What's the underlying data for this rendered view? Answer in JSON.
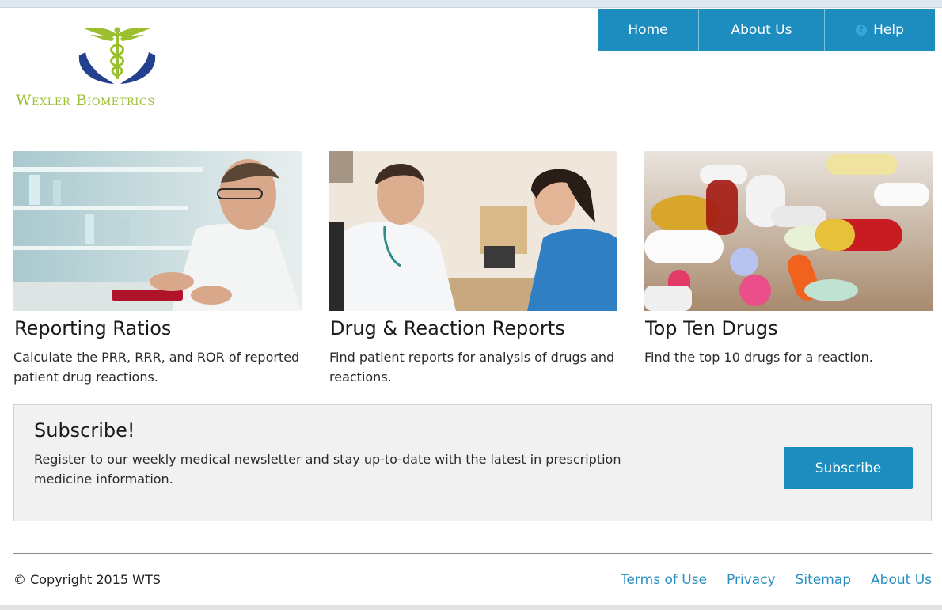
{
  "logo": {
    "text": "Wexler Biometrics",
    "icon": "caduceus-hands-icon",
    "colors": {
      "green": "#9bbf2f",
      "navy": "#23408e"
    }
  },
  "nav": {
    "items": [
      {
        "label": "Home"
      },
      {
        "label": "About Us"
      },
      {
        "label": "Help",
        "icon": "help-circle-icon"
      }
    ],
    "color": "#1d8dc0"
  },
  "cards": [
    {
      "title": "Reporting Ratios",
      "description": "Calculate the PRR, RRR, and ROR of reported patient drug reactions.",
      "image": "scientist-laboratory-photo"
    },
    {
      "title": "Drug & Reaction Reports",
      "description": "Find patient reports for analysis of drugs and reactions.",
      "image": "doctor-patient-consultation-photo"
    },
    {
      "title": "Top Ten Drugs",
      "description": "Find the top 10 drugs for a reaction.",
      "image": "assorted-pills-photo"
    }
  ],
  "subscribe": {
    "title": "Subscribe!",
    "text": "Register to our weekly medical newsletter and stay up-to-date with the latest in prescription medicine information.",
    "button_label": "Subscribe"
  },
  "footer": {
    "copyright": "© Copyright 2015 WTS",
    "links": [
      {
        "label": "Terms of Use"
      },
      {
        "label": "Privacy"
      },
      {
        "label": "Sitemap"
      },
      {
        "label": "About Us"
      }
    ],
    "link_color": "#2b8fc0"
  }
}
